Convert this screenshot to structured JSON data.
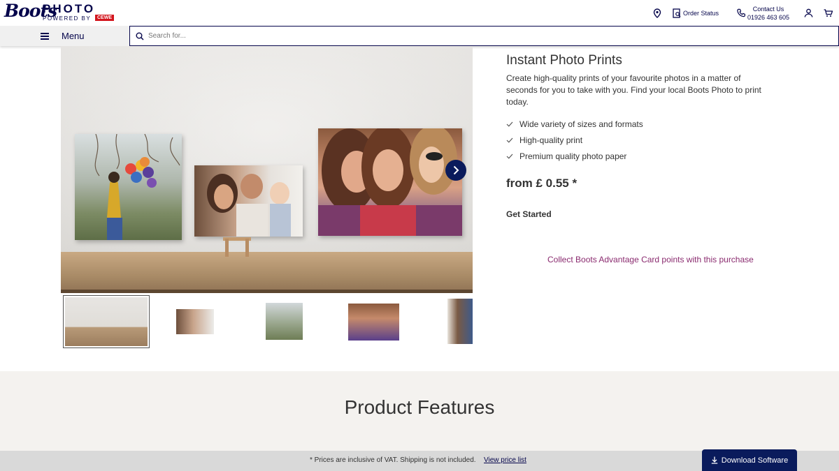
{
  "brand": {
    "script_logo": "Boots",
    "product_line": "PHOTO",
    "powered_by": "POWERED BY",
    "partner": "CEWE"
  },
  "header": {
    "order_status": "Order Status",
    "contact_title": "Contact Us",
    "contact_phone": "01926 463 605"
  },
  "nav": {
    "menu_label": "Menu",
    "search_placeholder": "Search for..."
  },
  "product": {
    "title": "Instant Photo Prints",
    "description": "Create high-quality prints of your favourite photos in a matter of seconds for you to take with you. Find your local Boots Photo to print today.",
    "features": [
      "Wide variety of sizes and formats",
      "High-quality print",
      "Premium quality photo paper"
    ],
    "price": "from £ 0.55 *",
    "cta": "Get Started",
    "advantage_link": "Collect Boots Advantage Card points with this purchase"
  },
  "gallery": {
    "thumbnail_count": 5,
    "selected_index": 0
  },
  "features_section": {
    "heading": "Product Features"
  },
  "footer": {
    "note": "* Prices are inclusive of VAT. Shipping is not included.",
    "price_link": "View price list",
    "download_button": "Download Software"
  },
  "colors": {
    "brand_navy": "#05054b",
    "button_navy": "#0a1b5c",
    "link_purple": "#8a2b6f",
    "cewe_red": "#d3151d",
    "section_bg": "#f4f2ef",
    "footer_bg": "#d9d9d9"
  },
  "icons": {
    "location": "map-pin-icon",
    "order_status": "order-status-icon",
    "contact": "phone-icon",
    "account": "user-icon",
    "cart": "cart-icon",
    "menu": "hamburger-icon",
    "search": "search-icon",
    "next": "chevron-right-icon",
    "check": "check-icon",
    "download": "download-icon"
  }
}
